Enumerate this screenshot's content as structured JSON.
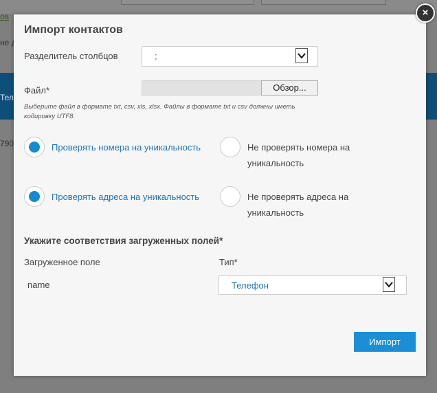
{
  "background": {
    "link_fragment": "ов",
    "text_fragment_1": "не д",
    "blue_fragment": "Тел",
    "text_fragment_2": "790"
  },
  "modal": {
    "title": "Импорт контактов",
    "close_symbol": "×",
    "separator": {
      "label": "Разделитель столбцов",
      "value": ";"
    },
    "file": {
      "label": "Файл*",
      "browse_label": "Обзор...",
      "hint": "Выберите файл в формате txt, csv, xls, xlsx. Файлы в формате txt и csv должны иметь кодировку UTF8."
    },
    "numbers_check": {
      "check_label": "Проверять номера на уникальность",
      "nocheck_label": "Не проверять номера на уникальность",
      "selected": "check"
    },
    "address_check": {
      "check_label": "Проверять адреса на уникальность",
      "nocheck_label": "Не проверять адреса на уникальность",
      "selected": "check"
    },
    "mapping": {
      "section_title": "Укажите соответствия загруженных полей*",
      "col_field": "Загруженное поле",
      "col_type": "Тип*",
      "rows": [
        {
          "field": "name",
          "type": "Телефон"
        }
      ]
    },
    "import_label": "Импорт"
  },
  "colors": {
    "accent": "#138ad1",
    "link_text": "#1e74b8",
    "button_bg": "#1a8fd6"
  }
}
